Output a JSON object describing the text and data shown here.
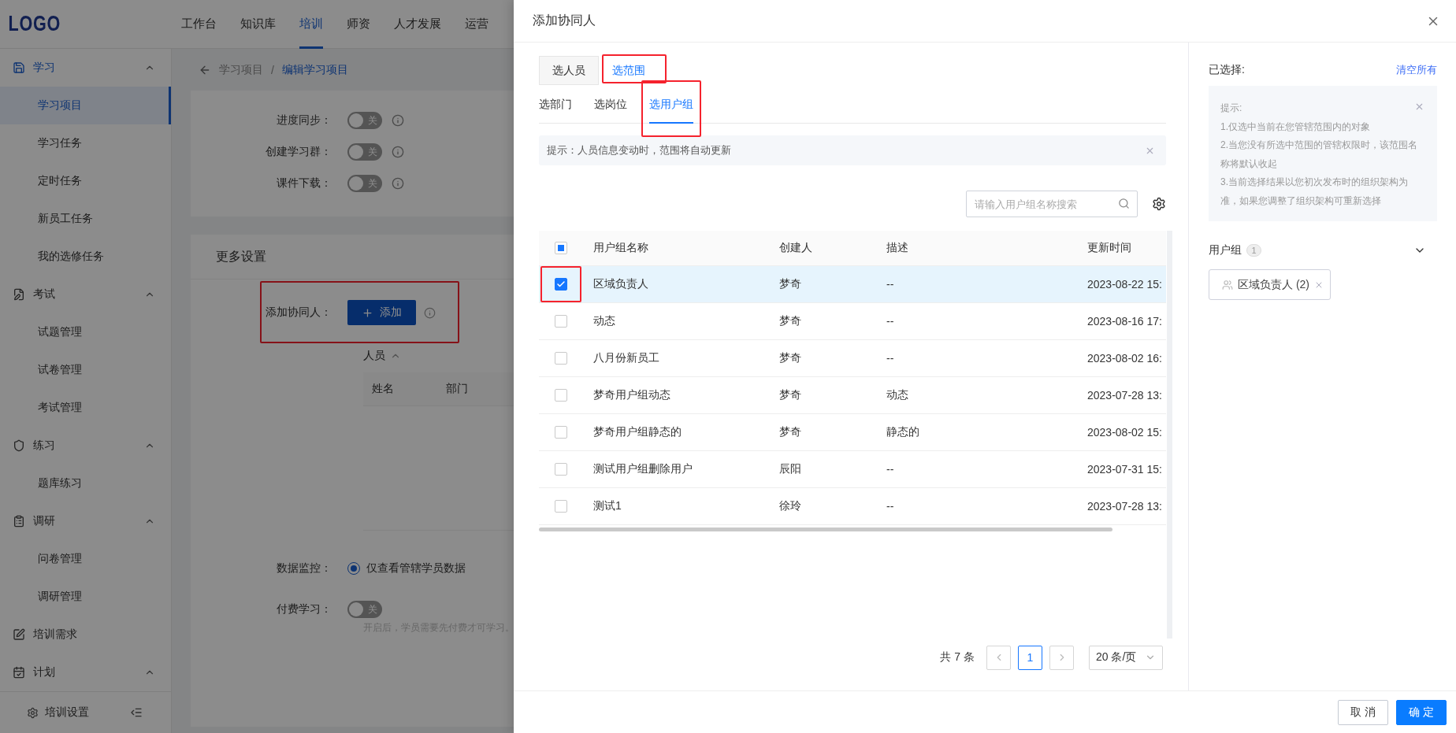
{
  "app": {
    "logo": "LOGO",
    "nav": [
      {
        "label": "工作台",
        "selected": false
      },
      {
        "label": "知识库",
        "selected": false
      },
      {
        "label": "培训",
        "selected": true
      },
      {
        "label": "师资",
        "selected": false
      },
      {
        "label": "人才发展",
        "selected": false
      },
      {
        "label": "运营",
        "selected": false
      }
    ]
  },
  "sidebar": {
    "groups": [
      {
        "label": "学习",
        "kind": "group",
        "expanded": true,
        "children": [
          {
            "label": "学习项目",
            "selected": true
          },
          {
            "label": "学习任务",
            "selected": false
          },
          {
            "label": "定时任务",
            "selected": false
          },
          {
            "label": "新员工任务",
            "selected": false
          },
          {
            "label": "我的选修任务",
            "selected": false
          }
        ]
      },
      {
        "label": "考试",
        "kind": "group",
        "expanded": true,
        "children": [
          {
            "label": "试题管理",
            "selected": false
          },
          {
            "label": "试卷管理",
            "selected": false
          },
          {
            "label": "考试管理",
            "selected": false
          }
        ]
      },
      {
        "label": "练习",
        "kind": "group",
        "expanded": true,
        "children": [
          {
            "label": "题库练习",
            "selected": false
          }
        ]
      },
      {
        "label": "调研",
        "kind": "group",
        "expanded": true,
        "children": [
          {
            "label": "问卷管理",
            "selected": false
          },
          {
            "label": "调研管理",
            "selected": false
          }
        ]
      },
      {
        "label": "培训需求",
        "kind": "link"
      },
      {
        "label": "计划",
        "kind": "group",
        "expanded": true
      }
    ],
    "footer": {
      "label": "培训设置"
    }
  },
  "breadcrumb": [
    "学习项目",
    "编辑学习项目"
  ],
  "breadcrumb_separator": "/",
  "switch_rows": [
    {
      "label": "进度同步：",
      "on": false,
      "state_text": "关"
    },
    {
      "label": "创建学习群：",
      "on": false,
      "state_text": "关"
    },
    {
      "label": "课件下载：",
      "on": false,
      "state_text": "关"
    }
  ],
  "more_settings": {
    "title": "更多设置",
    "add_collaborator": {
      "label": "添加协同人：",
      "button": "添加",
      "highlighted": true
    },
    "people_toggle": "人员",
    "people_columns": [
      "姓名",
      "部门"
    ],
    "data_monitor": {
      "label": "数据监控：",
      "option": "仅查看管辖学员数据",
      "selected": true
    },
    "paid": {
      "label": "付费学习：",
      "on": false,
      "state_text": "关",
      "hint": "开启后，学员需要先付费才可学习。"
    }
  },
  "drawer": {
    "title": "添加协同人",
    "tabs": [
      {
        "label": "选人员",
        "selected": false,
        "highlighted": false
      },
      {
        "label": "选范围",
        "selected": true,
        "highlighted": true
      }
    ],
    "sub_tabs": [
      {
        "label": "选部门",
        "selected": false,
        "highlighted": false
      },
      {
        "label": "选岗位",
        "selected": false,
        "highlighted": false
      },
      {
        "label": "选用户组",
        "selected": true,
        "highlighted": true
      }
    ],
    "notice": "提示：人员信息变动时，范围将自动更新",
    "search": {
      "placeholder": "请输入用户组名称搜索"
    },
    "table": {
      "header_checkbox": {
        "checked": false,
        "indeterminate": true
      },
      "columns": [
        "用户组名称",
        "创建人",
        "描述",
        "更新时间"
      ],
      "rows": [
        {
          "cells": [
            "区域负责人",
            "梦奇",
            "--",
            "2023-08-22 15:"
          ],
          "checked": true,
          "selected": true,
          "highlighted": true
        },
        {
          "cells": [
            "动态",
            "梦奇",
            "--",
            "2023-08-16 17:"
          ],
          "checked": false,
          "selected": false,
          "highlighted": false
        },
        {
          "cells": [
            "八月份新员工",
            "梦奇",
            "--",
            "2023-08-02 16:"
          ],
          "checked": false,
          "selected": false,
          "highlighted": false
        },
        {
          "cells": [
            "梦奇用户组动态",
            "梦奇",
            "动态",
            "2023-07-28 13:"
          ],
          "checked": false,
          "selected": false,
          "highlighted": false
        },
        {
          "cells": [
            "梦奇用户组静态的",
            "梦奇",
            "静态的",
            "2023-08-02 15:"
          ],
          "checked": false,
          "selected": false,
          "highlighted": false
        },
        {
          "cells": [
            "测试用户组删除用户",
            "辰阳",
            "--",
            "2023-07-31 15:"
          ],
          "checked": false,
          "selected": false,
          "highlighted": false
        },
        {
          "cells": [
            "测试1",
            "徐玲",
            "--",
            "2023-07-28 13:"
          ],
          "checked": false,
          "selected": false,
          "highlighted": false
        }
      ]
    },
    "pagination": {
      "total": "共 7 条",
      "pages": [
        {
          "label": "1",
          "selected": true
        }
      ],
      "page_size": "20 条/页"
    },
    "selected_panel": {
      "title": "已选择:",
      "clear": "清空所有",
      "tips": [
        "提示:",
        "1.仅选中当前在您管辖范围内的对象",
        "2.当您没有所选中范围的管辖权限时，该范围名称将默认收起",
        "3.当前选择结果以您初次发布时的组织架构为准，如果您调整了组织架构可重新选择"
      ],
      "group": {
        "label": "用户组",
        "count": "1",
        "expanded": true,
        "tags": [
          "区域负责人 (2)"
        ]
      }
    },
    "buttons": [
      {
        "label": "取 消",
        "kind": "secondary"
      },
      {
        "label": "确 定",
        "kind": "primary"
      }
    ]
  }
}
